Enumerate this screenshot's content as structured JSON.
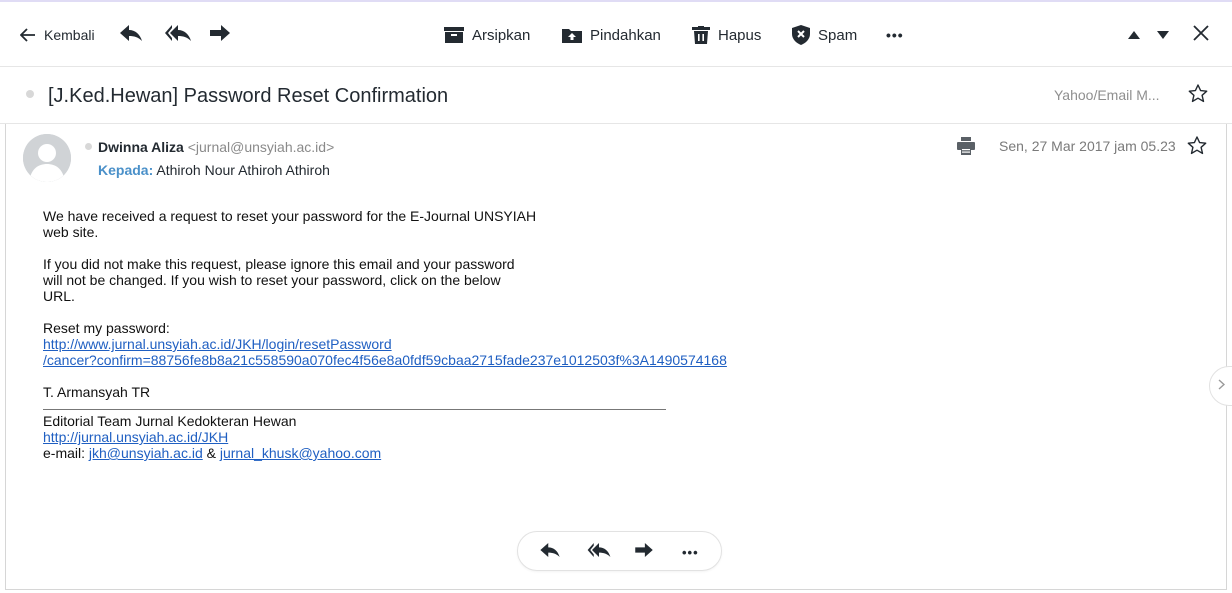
{
  "toolbar": {
    "back_label": "Kembali",
    "archive_label": "Arsipkan",
    "move_label": "Pindahkan",
    "delete_label": "Hapus",
    "spam_label": "Spam",
    "more_label": "•••"
  },
  "subject_bar": {
    "subject": "[J.Ked.Hewan] Password Reset Confirmation",
    "folder": "Yahoo/Email M..."
  },
  "message": {
    "sender_name": "Dwinna Aliza",
    "sender_email": "<jurnal@unsyiah.ac.id>",
    "to_label": "Kepada:",
    "to_value": "Athiroh Nour Athiroh Athiroh",
    "date": "Sen, 27 Mar 2017 jam 05.23",
    "body": {
      "p1_line1": "We have received a request to reset your password for the E-Journal UNSYIAH",
      "p1_line2": "web site.",
      "p2_line1": "If you did not make this request, please ignore this email and your password",
      "p2_line2": "will not be changed. If you wish to reset your password, click on the below",
      "p2_line3": "URL.",
      "reset_label": "Reset my password:",
      "reset_link_line1": "http://www.jurnal.unsyiah.ac.id/JKH/login/resetPassword",
      "reset_link_line2": "/cancer?confirm=88756fe8b8a21c558590a070fec4f56e8a0fdf59cbaa2715fade237e1012503f%3A1490574168",
      "signature_name": "T. Armansyah TR",
      "team_line": "Editorial Team Jurnal Kedokteran Hewan",
      "team_link": "http://jurnal.unsyiah.ac.id/JKH",
      "email_prefix": "e-mail: ",
      "email_1": "jkh@unsyiah.ac.id",
      "email_sep": " & ",
      "email_2": "jurnal_khusk@yahoo.com"
    },
    "more_label": "•••"
  },
  "colors": {
    "link": "#1f5fc2",
    "to_label": "#4a90c9",
    "icon": "#232a31",
    "muted": "#8a8a8a"
  },
  "icons": [
    "back-arrow-icon",
    "reply-icon",
    "reply-all-icon",
    "forward-icon",
    "archive-icon",
    "move-icon",
    "trash-icon",
    "spam-shield-icon",
    "more-icon",
    "up-triangle-icon",
    "down-triangle-icon",
    "close-icon",
    "star-icon",
    "print-icon",
    "avatar-icon",
    "chevron-right-icon"
  ]
}
